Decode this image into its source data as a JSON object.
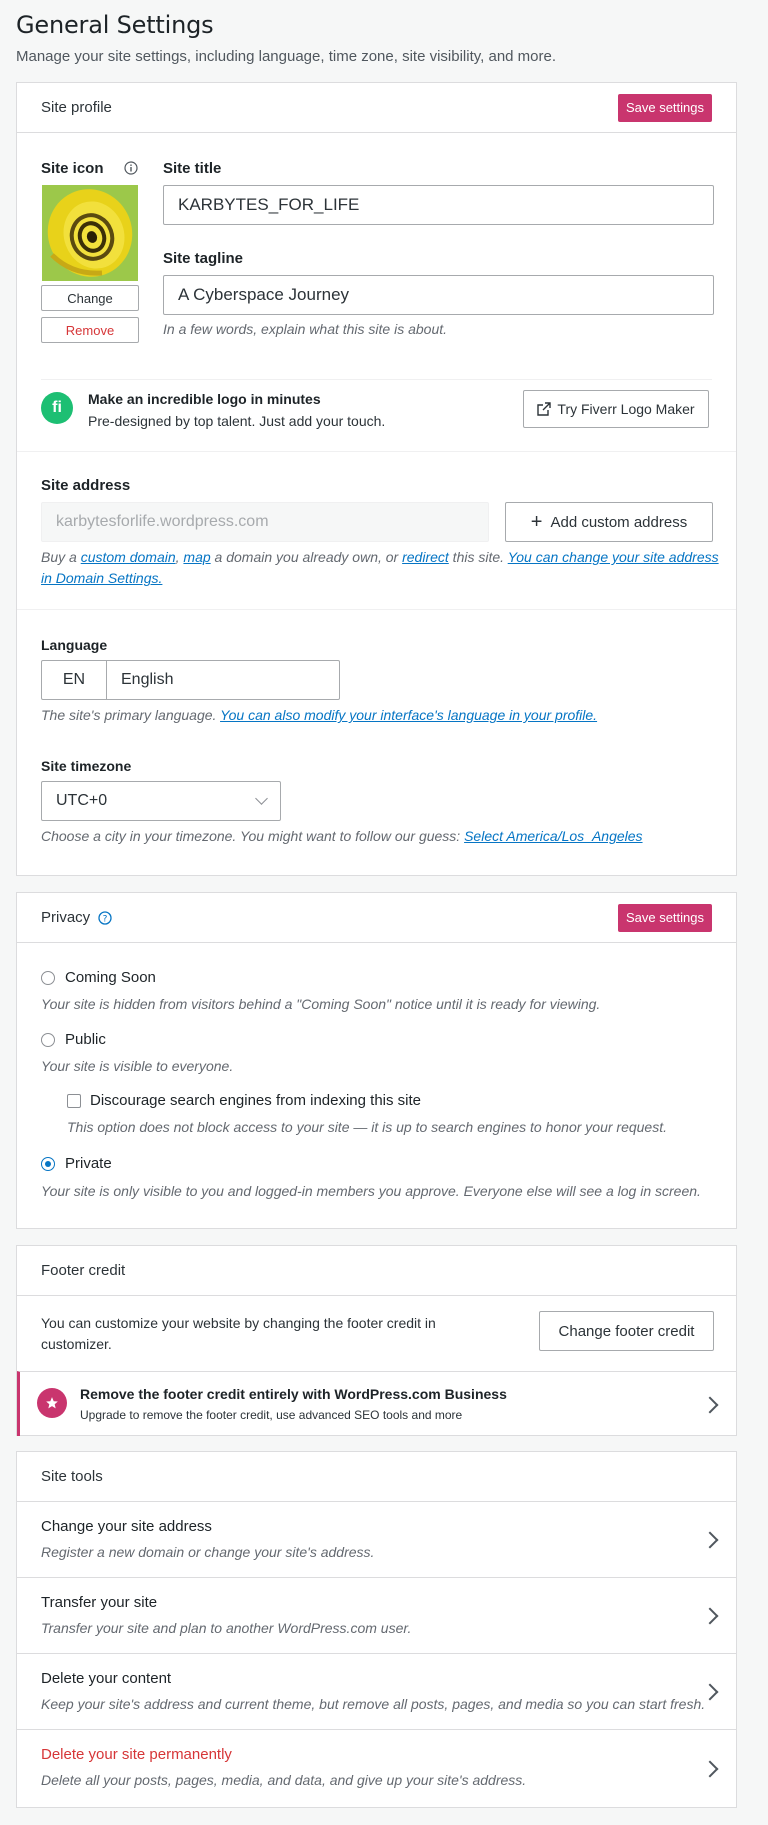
{
  "header": {
    "title": "General Settings",
    "subtitle": "Manage your site settings, including language, time zone, site visibility, and more."
  },
  "site_profile": {
    "title": "Site profile",
    "save_label": "Save settings",
    "site_icon_label": "Site icon",
    "change_label": "Change",
    "remove_label": "Remove",
    "site_title_label": "Site title",
    "site_title_value": "KARBYTES_FOR_LIFE",
    "tagline_label": "Site tagline",
    "tagline_value": "A Cyberspace Journey",
    "tagline_hint": "In a few words, explain what this site is about.",
    "fiverr": {
      "title": "Make an incredible logo in minutes",
      "subtitle": "Pre-designed by top talent. Just add your touch.",
      "button": "Try Fiverr Logo Maker",
      "logo_letter": "fi"
    },
    "address_label": "Site address",
    "address_value": "karbytesforlife.wordpress.com",
    "add_custom_address": "Add custom address",
    "address_hint": {
      "t1": "Buy a ",
      "l1": "custom domain",
      "t2": ", ",
      "l2": "map",
      "t3": " a domain you already own, or ",
      "l3": "redirect",
      "t4": " this site. ",
      "l4": "You can change your site address in Domain Settings."
    },
    "language_label": "Language",
    "language_code": "EN",
    "language_name": "English",
    "language_hint": "The site's primary language. ",
    "language_hint_link": "You can also modify your interface's language in your profile.",
    "timezone_label": "Site timezone",
    "timezone_value": "UTC+0",
    "timezone_hint": "Choose a city in your timezone. You might want to follow our guess: ",
    "timezone_hint_link": "Select America/Los_Angeles"
  },
  "privacy": {
    "title": "Privacy",
    "save_label": "Save settings",
    "coming_soon_label": "Coming Soon",
    "coming_soon_hint": "Your site is hidden from visitors behind a \"Coming Soon\" notice until it is ready for viewing.",
    "public_label": "Public",
    "public_hint": "Your site is visible to everyone.",
    "discourage_label": "Discourage search engines from indexing this site",
    "discourage_hint": "This option does not block access to your site — it is up to search engines to honor your request.",
    "private_label": "Private",
    "private_hint": "Your site is only visible to you and logged-in members you approve. Everyone else will see a log in screen.",
    "selected": "Private"
  },
  "footer_credit": {
    "title": "Footer credit",
    "text": "You can customize your website by changing the footer credit in customizer.",
    "button": "Change footer credit",
    "upsell_title": "Remove the footer credit entirely with WordPress.com Business",
    "upsell_sub": "Upgrade to remove the footer credit, use advanced SEO tools and more"
  },
  "site_tools": {
    "title": "Site tools",
    "items": [
      {
        "title": "Change your site address",
        "desc": "Register a new domain or change your site's address."
      },
      {
        "title": "Transfer your site",
        "desc": "Transfer your site and plan to another WordPress.com user."
      },
      {
        "title": "Delete your content",
        "desc": "Keep your site's address and current theme, but remove all posts, pages, and media so you can start fresh."
      },
      {
        "title": "Delete your site permanently",
        "desc": "Delete all your posts, pages, media, and data, and give up your site's address."
      }
    ]
  },
  "colors": {
    "accent": "#c9356e",
    "link": "#0675c4",
    "danger": "#d63638"
  }
}
